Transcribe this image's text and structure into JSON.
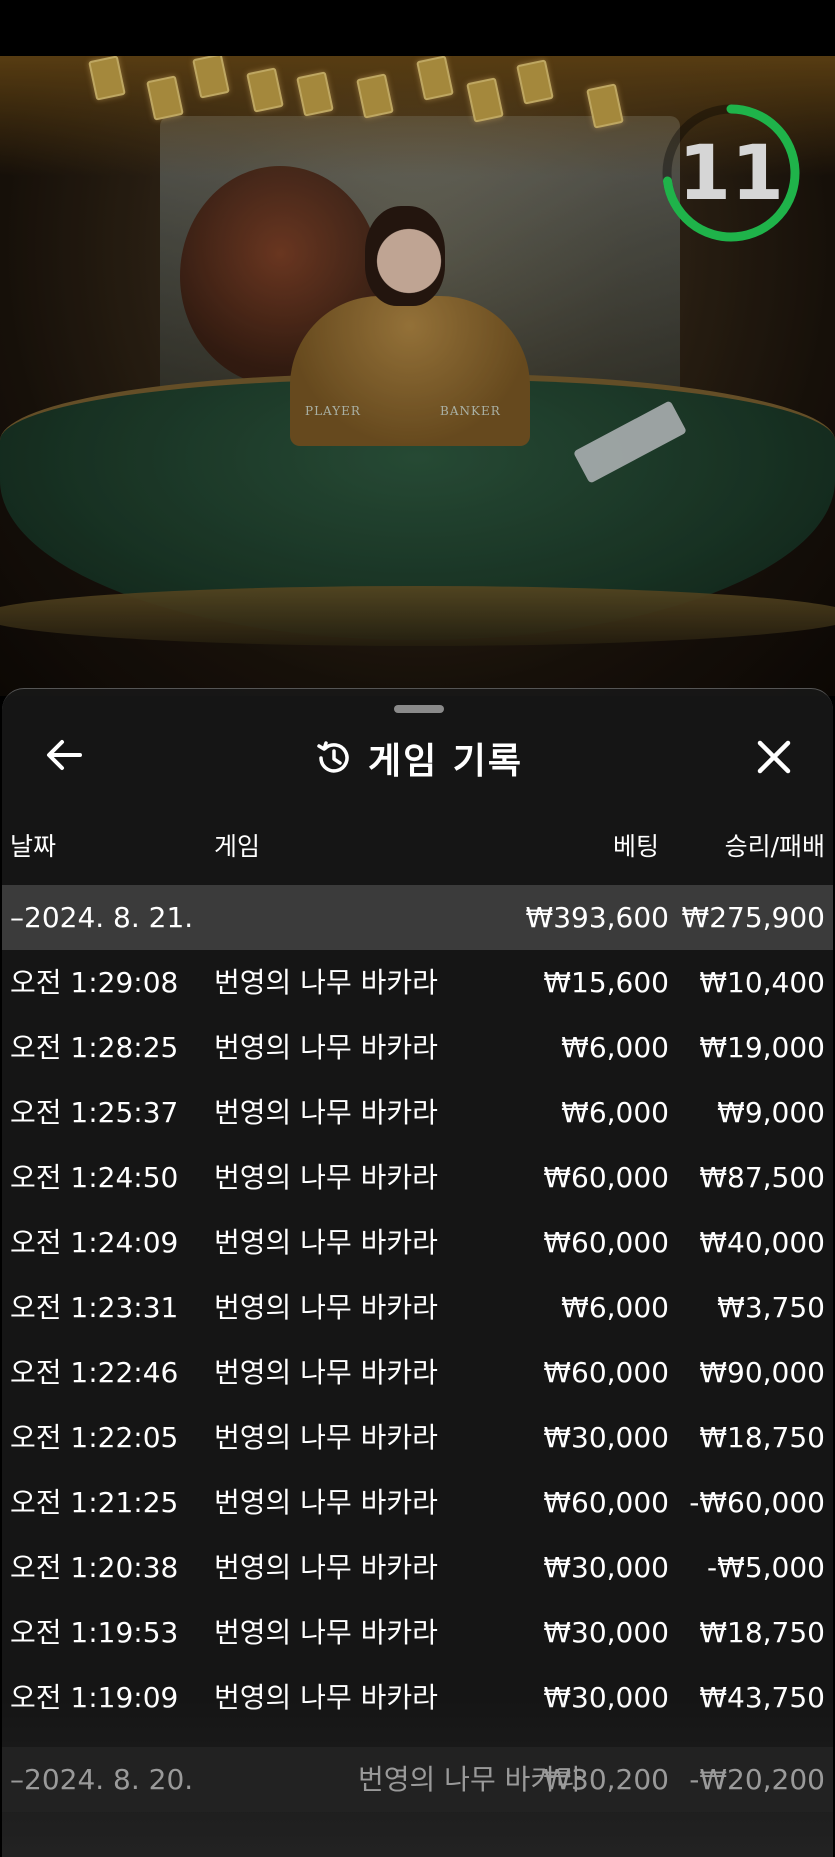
{
  "video": {
    "countdown": "11",
    "table_labels": {
      "player": "PLAYER",
      "banker": "BANKER"
    },
    "timer_color": "#1fb34a"
  },
  "sheet": {
    "title": "게임 기록",
    "back_icon": "arrow-left-icon",
    "history_icon": "history-clock-icon",
    "close_icon": "close-icon"
  },
  "table": {
    "headers": {
      "date": "날짜",
      "game": "게임",
      "bet": "베팅",
      "result": "승리/패배"
    },
    "group_1": {
      "date": "–2024. 8. 21.",
      "bet": "₩393,600",
      "result": "₩275,900"
    },
    "rows": [
      {
        "time": "오전 1:29:08",
        "game": "번영의 나무 바카라",
        "bet": "₩15,600",
        "result": "₩10,400"
      },
      {
        "time": "오전 1:28:25",
        "game": "번영의 나무 바카라",
        "bet": "₩6,000",
        "result": "₩19,000"
      },
      {
        "time": "오전 1:25:37",
        "game": "번영의 나무 바카라",
        "bet": "₩6,000",
        "result": "₩9,000"
      },
      {
        "time": "오전 1:24:50",
        "game": "번영의 나무 바카라",
        "bet": "₩60,000",
        "result": "₩87,500"
      },
      {
        "time": "오전 1:24:09",
        "game": "번영의 나무 바카라",
        "bet": "₩60,000",
        "result": "₩40,000"
      },
      {
        "time": "오전 1:23:31",
        "game": "번영의 나무 바카라",
        "bet": "₩6,000",
        "result": "₩3,750"
      },
      {
        "time": "오전 1:22:46",
        "game": "번영의 나무 바카라",
        "bet": "₩60,000",
        "result": "₩90,000"
      },
      {
        "time": "오전 1:22:05",
        "game": "번영의 나무 바카라",
        "bet": "₩30,000",
        "result": "₩18,750"
      },
      {
        "time": "오전 1:21:25",
        "game": "번영의 나무 바카라",
        "bet": "₩60,000",
        "result": "-₩60,000"
      },
      {
        "time": "오전 1:20:38",
        "game": "번영의 나무 바카라",
        "bet": "₩30,000",
        "result": "-₩5,000"
      },
      {
        "time": "오전 1:19:53",
        "game": "번영의 나무 바카라",
        "bet": "₩30,000",
        "result": "₩18,750"
      },
      {
        "time": "오전 1:19:09",
        "game": "번영의 나무 바카라",
        "bet": "₩30,000",
        "result": "₩43,750"
      }
    ],
    "group_2": {
      "date": "–2024. 8. 20.",
      "game": "번영의 나무 바카라",
      "bet": "₩30,200",
      "result": "-₩20,200"
    }
  }
}
